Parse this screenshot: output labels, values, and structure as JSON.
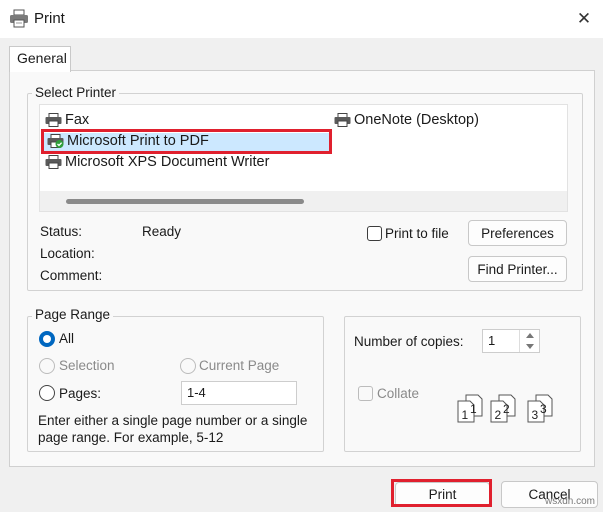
{
  "window": {
    "title": "Print",
    "close_glyph": "✕",
    "icon": "printer-icon"
  },
  "tabs": [
    {
      "label": "General",
      "selected": true
    }
  ],
  "select_printer": {
    "legend": "Select Printer",
    "printers": [
      {
        "name": "Fax",
        "icon": "fax-printer-icon"
      },
      {
        "name": "Microsoft Print to PDF",
        "icon": "default-printer-icon",
        "selected": true,
        "default": true
      },
      {
        "name": "Microsoft XPS Document Writer",
        "icon": "printer-icon"
      },
      {
        "name": "OneNote (Desktop)",
        "icon": "printer-icon"
      }
    ],
    "status_label": "Status:",
    "status_value": "Ready",
    "location_label": "Location:",
    "location_value": "",
    "comment_label": "Comment:",
    "comment_value": "",
    "print_to_file_label": "Print to file",
    "print_to_file_checked": false,
    "preferences_label": "Preferences",
    "find_printer_label": "Find Printer..."
  },
  "page_range": {
    "legend": "Page Range",
    "all_label": "All",
    "all_selected": true,
    "selection_label": "Selection",
    "selection_enabled": false,
    "current_page_label": "Current Page",
    "current_page_enabled": false,
    "pages_label": "Pages:",
    "pages_value": "1-4",
    "help_text": "Enter either a single page number or a single page range.  For example, 5-12"
  },
  "copies": {
    "label": "Number of copies:",
    "value": "1",
    "collate_label": "Collate",
    "collate_enabled": false,
    "collate_checked": false,
    "collate_pages": [
      "1",
      "1",
      "2",
      "2",
      "3",
      "3"
    ]
  },
  "footer": {
    "print_label": "Print",
    "cancel_label": "Cancel"
  },
  "watermark": "wsxdn.com",
  "colors": {
    "highlight_border": "#e0202e",
    "accent": "#0067c0",
    "selection_bg": "#cce8ff"
  }
}
